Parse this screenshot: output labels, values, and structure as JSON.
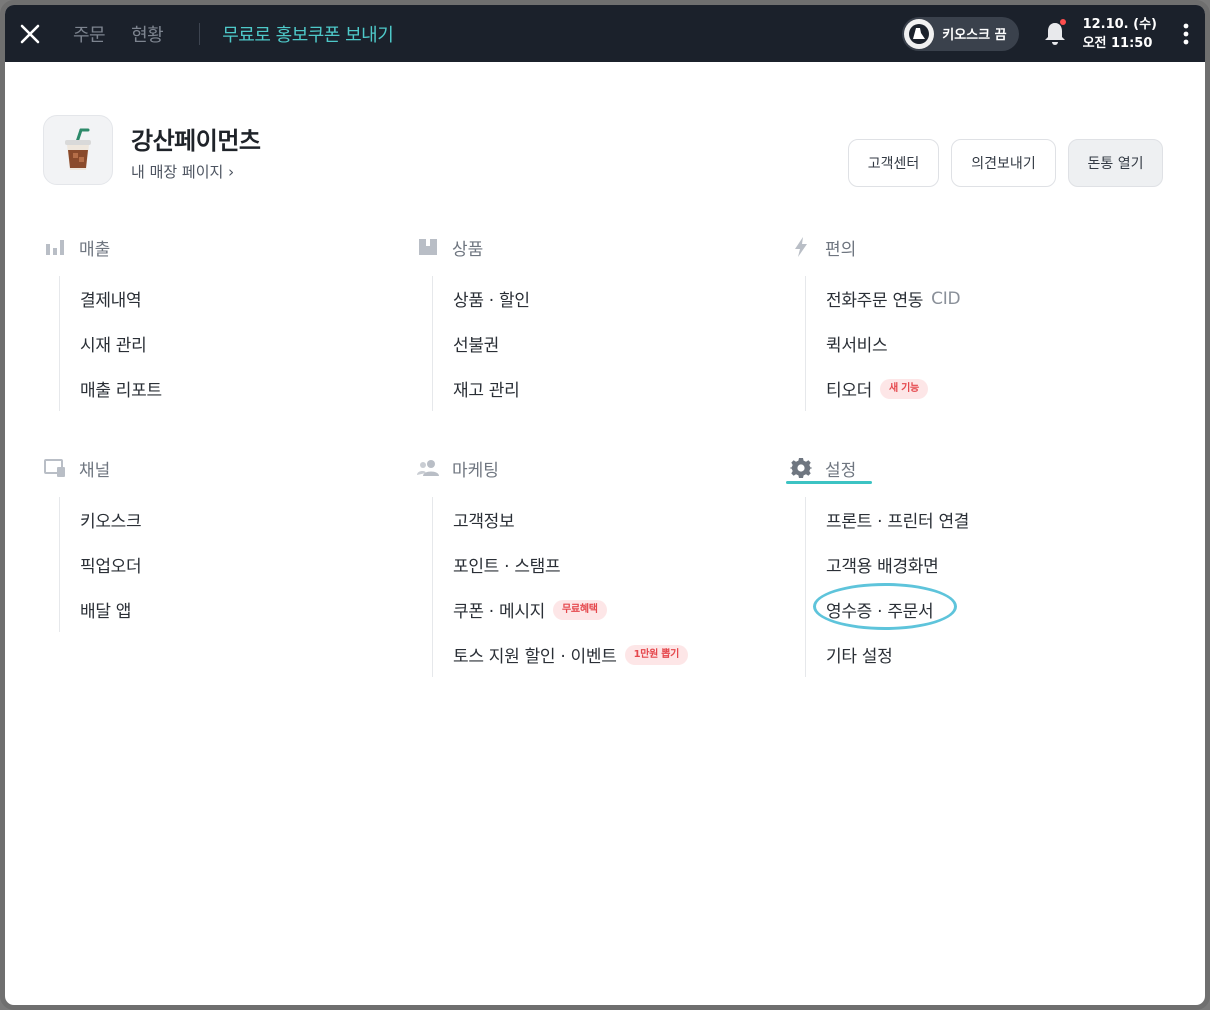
{
  "topbar": {
    "tabs": [
      "주문",
      "현황"
    ],
    "promo": "무료로 홍보쿠폰 보내기",
    "kiosk_label": "키오스크 끔",
    "date": "12.10. (수)",
    "time": "오전 11:50"
  },
  "store": {
    "name": "강산페이먼츠",
    "link": "내 매장 페이지 ›",
    "buttons": [
      "고객센터",
      "의견보내기",
      "돈통 열기"
    ]
  },
  "sections": {
    "sales": {
      "title": "매출",
      "items": [
        "결제내역",
        "시재 관리",
        "매출 리포트"
      ]
    },
    "products": {
      "title": "상품",
      "items": [
        "상품 · 할인",
        "선불권",
        "재고 관리"
      ]
    },
    "convenience": {
      "title": "편의",
      "items": [
        "전화주문 연동",
        "퀵서비스",
        "티오더"
      ],
      "cid": "CID",
      "new_badge": "새 기능"
    },
    "channel": {
      "title": "채널",
      "items": [
        "키오스크",
        "픽업오더",
        "배달 앱"
      ]
    },
    "marketing": {
      "title": "마케팅",
      "items": [
        "고객정보",
        "포인트 · 스탬프",
        "쿠폰 · 메시지",
        "토스 지원 할인 · 이벤트"
      ],
      "free_badge": "무료혜택",
      "win_badge": "1만원 뽑기"
    },
    "settings": {
      "title": "설정",
      "items": [
        "프론트 · 프린터 연결",
        "고객용 배경화면",
        "영수증 · 주문서",
        "기타 설정"
      ]
    }
  },
  "colors": {
    "topbar": "#1b212b",
    "accent": "#4ec9c9",
    "badge_red": "#e5484d"
  }
}
